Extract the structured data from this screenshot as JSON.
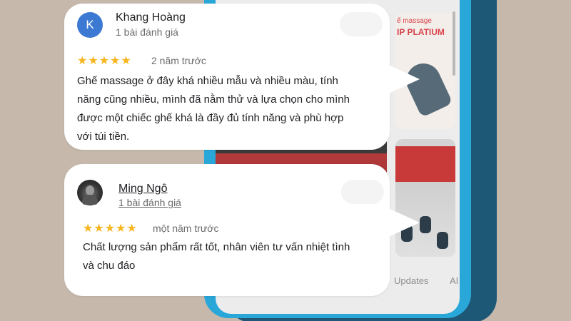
{
  "reviews": [
    {
      "avatar_letter": "K",
      "avatar_color": "#3c79d3",
      "name": "Khang Hoàng",
      "review_count": "1 bài đánh giá",
      "stars": "★★★★★",
      "rating": 5,
      "time": "2 năm trước",
      "text_lines": [
        "Ghế massage ở đây khá nhiều mẫu và nhiều màu, tính",
        "năng cũng nhiều, mình đã nằm thử và lựa chọn cho mình",
        "được một chiếc ghế khá là đầy đủ tính năng và phù hợp",
        "với túi tiền."
      ]
    },
    {
      "name": "Ming Ngô",
      "review_count": "1 bài đánh giá",
      "stars": "★★★★★",
      "rating": 5,
      "time": "một năm trước",
      "text_lines": [
        "Chất lượng sản phẩm rất tốt, nhân viên tư vấn nhiệt tình",
        "và chu đáo"
      ]
    }
  ],
  "phone": {
    "thumb_text_1": "ế massage",
    "thumb_text_2": "IP PLATIUM",
    "tabs": [
      "Updates",
      "AI"
    ],
    "frame_color": "#29a7d8",
    "star_color": "#f7b51e"
  }
}
